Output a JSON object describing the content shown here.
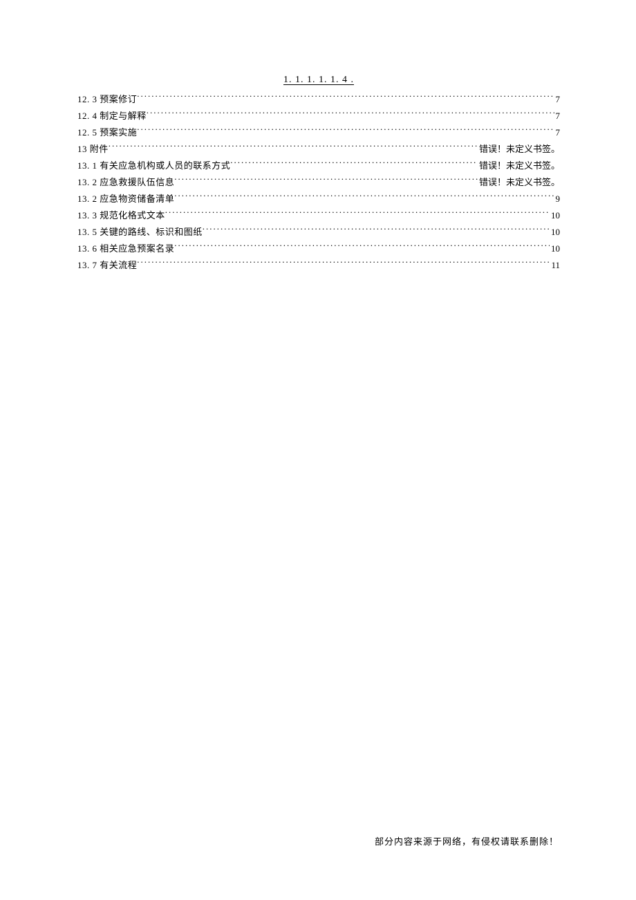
{
  "header": "1. 1. 1. 1. 1. 4   .",
  "toc": [
    {
      "label": "12. 3 预案修订",
      "page": "7",
      "error": false
    },
    {
      "label": "12. 4 制定与解释",
      "page": "7",
      "error": false
    },
    {
      "label": "12. 5 预案实施",
      "page": "7",
      "error": false
    },
    {
      "label": "13 附件 ",
      "page": "错误！未定义书签。",
      "error": true
    },
    {
      "label": "13. 1 有关应急机构或人员的联系方式 ",
      "page": "错误！未定义书签。",
      "error": true
    },
    {
      "label": "13. 2 应急救援队伍信息 ",
      "page": "错误！未定义书签。",
      "error": true
    },
    {
      "label": "13. 2 应急物资储备清单",
      "page": "9",
      "error": false
    },
    {
      "label": "13. 3 规范化格式文本",
      "page": "10",
      "error": false
    },
    {
      "label": "13. 5 关键的路线、标识和图纸",
      "page": "10",
      "error": false
    },
    {
      "label": "13. 6 相关应急预案名录",
      "page": "10",
      "error": false
    },
    {
      "label": "13. 7 有关流程",
      "page": "11",
      "error": false
    }
  ],
  "footer": "部分内容来源于网络，有侵权请联系删除！"
}
